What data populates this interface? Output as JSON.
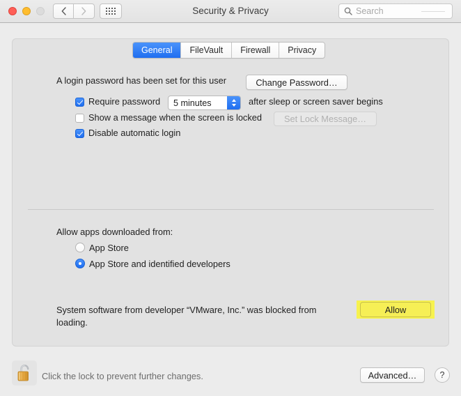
{
  "window": {
    "title": "Security & Privacy",
    "traffic_lights": [
      "close",
      "minimize",
      "zoom"
    ],
    "nav": {
      "back": "‹",
      "forward": "›",
      "grid": "show-all-grid-icon"
    },
    "search": {
      "placeholder": "Search",
      "value": ""
    }
  },
  "tabs": [
    {
      "label": "General",
      "active": true
    },
    {
      "label": "FileVault",
      "active": false
    },
    {
      "label": "Firewall",
      "active": false
    },
    {
      "label": "Privacy",
      "active": false
    }
  ],
  "general": {
    "login_password_text": "A login password has been set for this user",
    "change_password_label": "Change Password…",
    "require_password": {
      "checked": true,
      "label_before": "Require password",
      "interval_value": "5 minutes",
      "label_after": "after sleep or screen saver begins"
    },
    "show_message": {
      "checked": false,
      "label": "Show a message when the screen is locked",
      "set_lock_message_label": "Set Lock Message…",
      "set_lock_message_disabled": true
    },
    "disable_auto_login": {
      "checked": true,
      "label": "Disable automatic login"
    },
    "allow_apps_heading": "Allow apps downloaded from:",
    "allow_apps_options": [
      {
        "label": "App Store",
        "selected": false
      },
      {
        "label": "App Store and identified developers",
        "selected": true
      }
    ],
    "blocked_notice": "System software from developer “VMware, Inc.” was blocked from loading.",
    "allow_button_label": "Allow"
  },
  "footer": {
    "lock_icon": "unlocked-padlock-icon",
    "lock_caption": "Click the lock to prevent further changes.",
    "advanced_label": "Advanced…",
    "help_label": "?"
  },
  "colors": {
    "accent_blue": "#1f6ef0",
    "highlight_yellow": "#f7f24f",
    "window_bg": "#ececec",
    "panel_bg": "#e2e2e2"
  }
}
